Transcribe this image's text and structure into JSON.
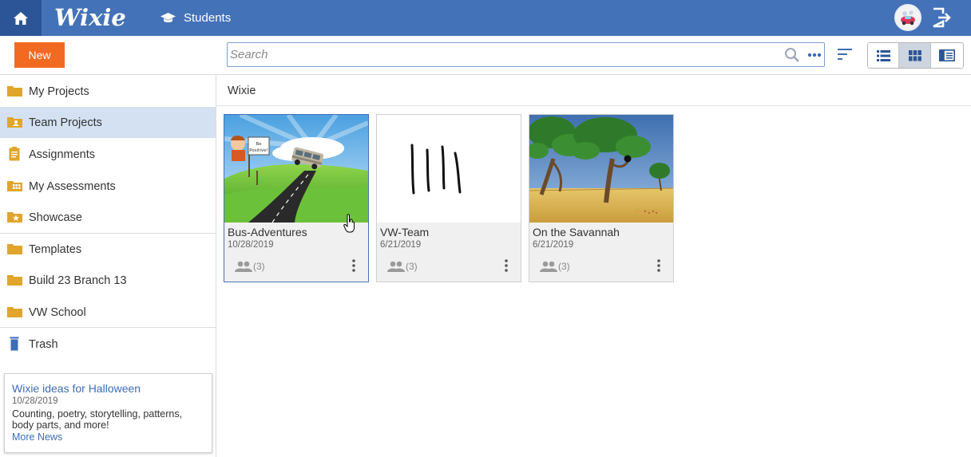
{
  "app": {
    "logo_text": "Wixie",
    "students_label": "Students",
    "brand_color": "#4472b8",
    "accent_color": "#f26a21"
  },
  "toolbar": {
    "new_label": "New",
    "search_placeholder": "Search",
    "view_modes": [
      "list",
      "grid",
      "detail"
    ],
    "active_view": "grid"
  },
  "sidebar": {
    "items": [
      {
        "label": "My Projects",
        "icon": "folder-icon"
      },
      {
        "label": "Team Projects",
        "icon": "team-folder-icon",
        "selected": true
      },
      {
        "label": "Assignments",
        "icon": "clipboard-icon"
      },
      {
        "label": "My Assessments",
        "icon": "grid-folder-icon"
      },
      {
        "label": "Showcase",
        "icon": "star-folder-icon"
      },
      {
        "label": "Templates",
        "icon": "folder-icon"
      },
      {
        "label": "Build 23 Branch 13",
        "icon": "folder-icon"
      },
      {
        "label": "VW School",
        "icon": "folder-icon"
      },
      {
        "label": "Trash",
        "icon": "trash-icon"
      }
    ]
  },
  "news": {
    "title": "Wixie ideas for Halloween",
    "date": "10/28/2019",
    "text": "Counting, poetry, storytelling, patterns, body parts, and more!",
    "more_label": "More News"
  },
  "main": {
    "breadcrumb": "Wixie",
    "projects": [
      {
        "title": "Bus-Adventures",
        "date": "10/28/2019",
        "shared": "(3)",
        "selected": true
      },
      {
        "title": "VW-Team",
        "date": "6/21/2019",
        "shared": "(3)"
      },
      {
        "title": "On the Savannah",
        "date": "6/21/2019",
        "shared": "(3)"
      }
    ],
    "bus_sign": [
      "Be",
      "Positive!"
    ]
  }
}
